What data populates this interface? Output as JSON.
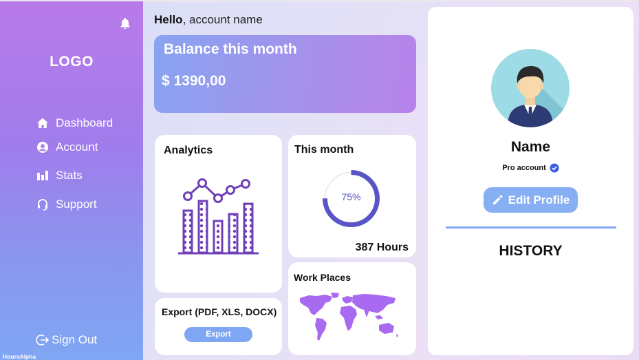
{
  "brand": {
    "logo": "LOGO",
    "footer": "HoursAlpha"
  },
  "sidebar": {
    "items": [
      {
        "label": "Dashboard",
        "icon": "home-icon"
      },
      {
        "label": "Account",
        "icon": "account-icon"
      },
      {
        "label": "Stats",
        "icon": "bar-chart-icon"
      },
      {
        "label": "Support",
        "icon": "headset-icon"
      }
    ],
    "signout_label": "Sign Out"
  },
  "greeting": {
    "hello": "Hello",
    "rest": ", account name"
  },
  "balance": {
    "title": "Balance this month",
    "amount": "$ 1390,00"
  },
  "analytics": {
    "title": "Analytics"
  },
  "this_month": {
    "title": "This month",
    "progress": 0.75,
    "percent_label": "75%",
    "hours_label": "387 Hours"
  },
  "export": {
    "title": "Export (PDF, XLS, DOCX)",
    "button_label": "Export"
  },
  "work_places": {
    "title": "Work Places"
  },
  "profile": {
    "name": "Name",
    "account_type": "Pro account",
    "edit_label": "Edit Profile",
    "history_label": "HISTORY"
  },
  "colors": {
    "accent_purple": "#6f3fb8",
    "ring_blue": "#5a55c7",
    "button_blue": "#7fa6f3",
    "map_purple": "#a86af0"
  }
}
